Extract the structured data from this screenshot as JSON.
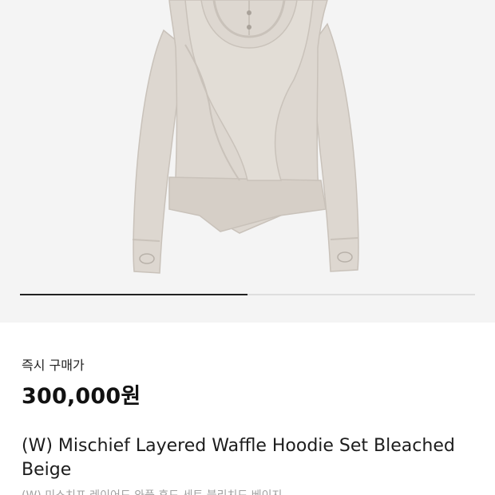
{
  "gallery": {
    "image_alt": "Mischief Layered Waffle Hoodie Set",
    "progress_fraction": 0.5
  },
  "price": {
    "label": "즉시 구매가",
    "value": "300,000원"
  },
  "product": {
    "name_en": "(W) Mischief Layered Waffle Hoodie Set Bleached Beige",
    "name_ko": "(W) 미스치프 레이어드 와플 후드 세트 블리치드 베이지"
  },
  "colors": {
    "garment": "#ddd7d0",
    "garment_shadow": "#c9c2ba",
    "background": "#f4f4f4"
  }
}
